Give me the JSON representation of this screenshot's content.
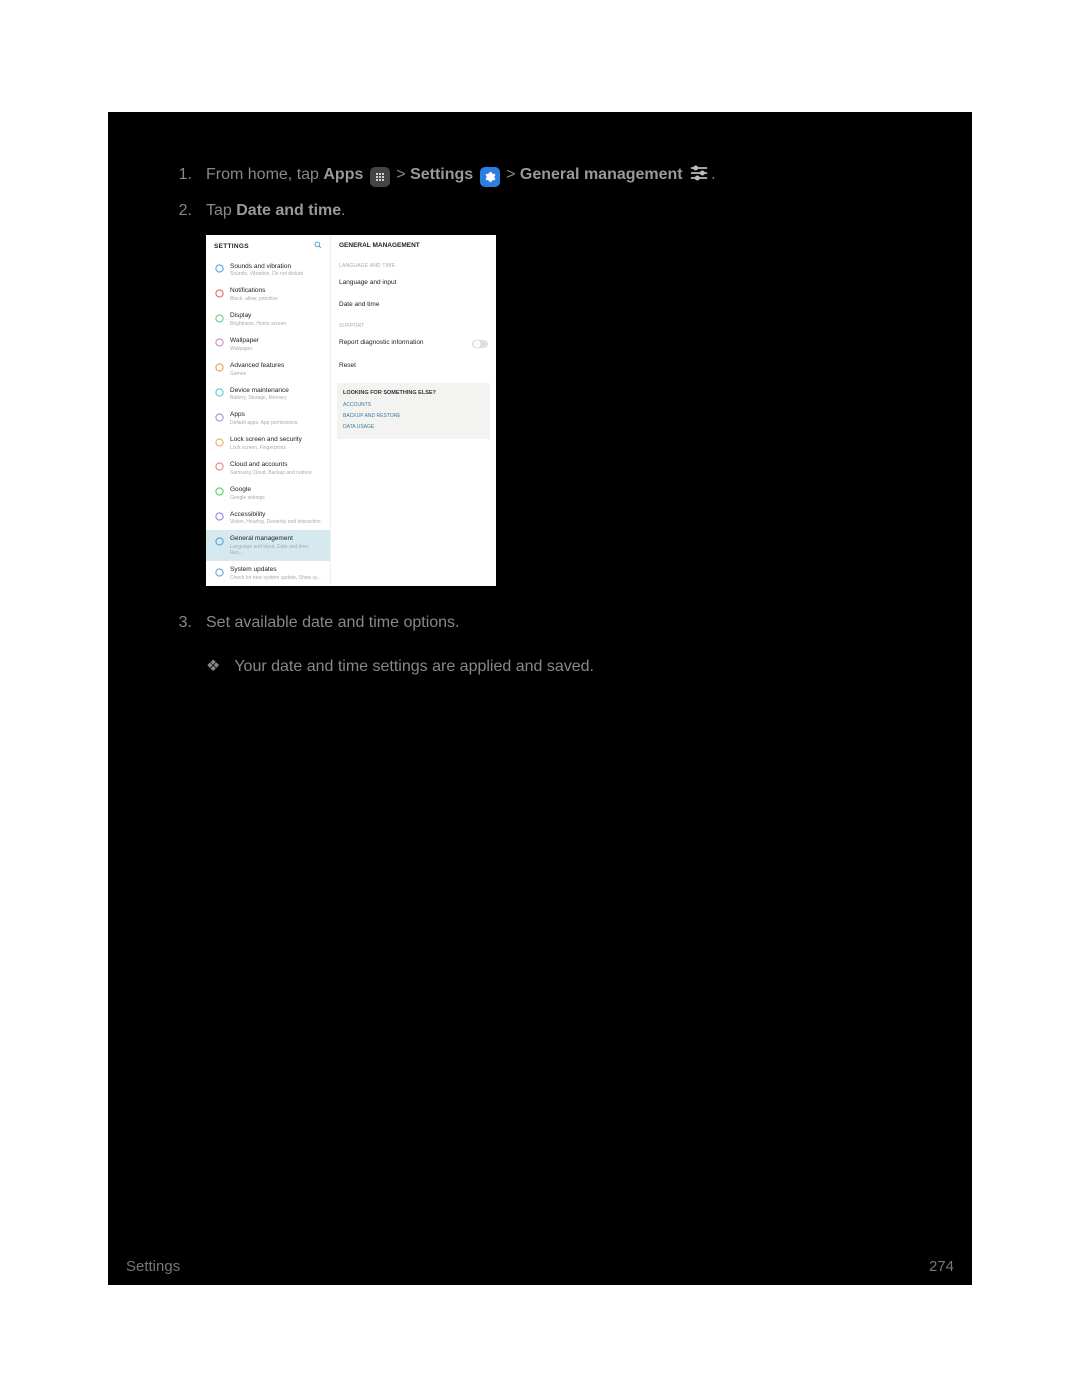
{
  "steps": {
    "s1": {
      "num": "1.",
      "prefix": "From home, tap ",
      "apps": "Apps",
      "gt1": " > ",
      "settings": "Settings",
      "gt2": " > ",
      "gm": "General management",
      "tail": "."
    },
    "s2": {
      "num": "2.",
      "prefix": "Tap ",
      "bold": "Date and time",
      "tail": "."
    },
    "s3": {
      "num": "3.",
      "text": "Set available date and time options."
    },
    "result": "Your date and time settings are applied and saved."
  },
  "bullet_glyph": "❖",
  "screenshot": {
    "left_header": "SETTINGS",
    "right_header": "GENERAL MANAGEMENT",
    "left_items": [
      {
        "title": "Sounds and vibration",
        "sub": "Sounds, Vibration, Do not disturb",
        "icon": "sound"
      },
      {
        "title": "Notifications",
        "sub": "Block, allow, prioritize",
        "icon": "notif"
      },
      {
        "title": "Display",
        "sub": "Brightness, Home screen",
        "icon": "display"
      },
      {
        "title": "Wallpaper",
        "sub": "Wallpaper",
        "icon": "wallpaper"
      },
      {
        "title": "Advanced features",
        "sub": "Games",
        "icon": "advanced"
      },
      {
        "title": "Device maintenance",
        "sub": "Battery, Storage, Memory",
        "icon": "maint"
      },
      {
        "title": "Apps",
        "sub": "Default apps, App permissions",
        "icon": "apps"
      },
      {
        "title": "Lock screen and security",
        "sub": "Lock screen, Fingerprints",
        "icon": "lock"
      },
      {
        "title": "Cloud and accounts",
        "sub": "Samsung Cloud, Backup and restore",
        "icon": "cloud"
      },
      {
        "title": "Google",
        "sub": "Google settings",
        "icon": "google"
      },
      {
        "title": "Accessibility",
        "sub": "Vision, Hearing, Dexterity and interaction",
        "icon": "accessibility"
      },
      {
        "title": "General management",
        "sub": "Language and input, Date and time, Res...",
        "icon": "general",
        "selected": true
      },
      {
        "title": "System updates",
        "sub": "Check for new system update, Show sy...",
        "icon": "update"
      }
    ],
    "right": {
      "section1": "LANGUAGE AND TIME",
      "item1": "Language and input",
      "item2": "Date and time",
      "section2": "SUPPORT",
      "item3": "Report diagnostic information",
      "item4": "Reset",
      "box_title": "LOOKING FOR SOMETHING ELSE?",
      "link1": "ACCOUNTS",
      "link2": "BACKUP AND RESTORE",
      "link3": "DATA USAGE"
    }
  },
  "footer": {
    "left": "Settings",
    "right": "274"
  },
  "icon_colors": {
    "sound": "#4da6e0",
    "notif": "#e06666",
    "display": "#66cc88",
    "wallpaper": "#cc88cc",
    "advanced": "#e6a04d",
    "maint": "#4dd0d0",
    "apps": "#b088d0",
    "lock": "#e0b060",
    "cloud": "#e08888",
    "google": "#4dd060",
    "accessibility": "#8888e0",
    "general": "#4da6e0",
    "update": "#66a0cc"
  }
}
